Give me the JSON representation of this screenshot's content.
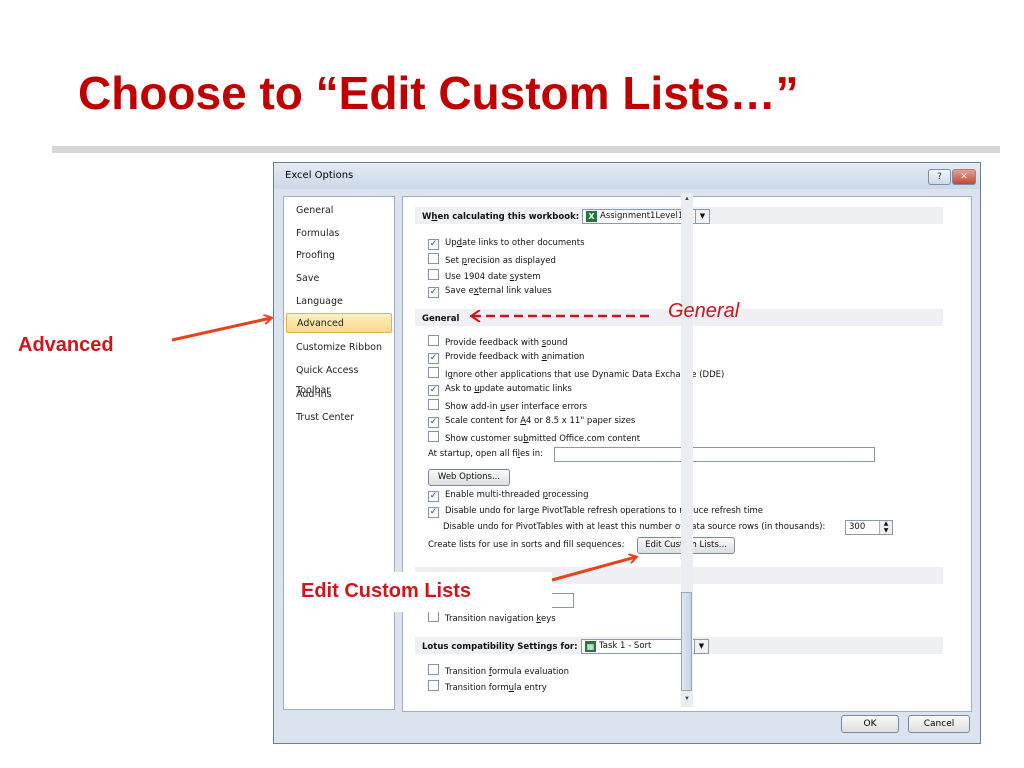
{
  "slide": {
    "title": "Choose to “Edit Custom Lists…”"
  },
  "dialog": {
    "title": "Excel Options",
    "help_label": "?",
    "close_label": "✕",
    "nav": [
      {
        "label": "General"
      },
      {
        "label": "Formulas"
      },
      {
        "label": "Proofing"
      },
      {
        "label": "Save"
      },
      {
        "label": "Language"
      },
      {
        "label": "Advanced",
        "selected": true
      },
      {
        "label": "Customize Ribbon"
      },
      {
        "label": "Quick Access Toolbar"
      },
      {
        "label": "Add-Ins"
      },
      {
        "label": "Trust Center"
      }
    ],
    "when_calculating": {
      "label_pre": "W",
      "label_u": "h",
      "label_post": "en calculating this workbook:",
      "workbook_value": "Assignment1Level1 ...",
      "options": [
        {
          "pre": "Up",
          "u": "d",
          "post": "ate links to other documents",
          "checked": true
        },
        {
          "pre": "Set ",
          "u": "p",
          "post": "recision as displayed",
          "checked": false
        },
        {
          "pre": "Use 1904 date ",
          "u": "s",
          "post": "ystem",
          "checked": false
        },
        {
          "pre": "Save e",
          "u": "x",
          "post": "ternal link values",
          "checked": true
        }
      ]
    },
    "general": {
      "header": "General",
      "options": [
        {
          "pre": "Provide feedback with ",
          "u": "s",
          "post": "ound",
          "checked": false
        },
        {
          "pre": "Provide feedback with ",
          "u": "a",
          "post": "nimation",
          "checked": true
        },
        {
          "pre": "I",
          "u": "g",
          "post": "nore other applications that use Dynamic Data Exchange (DDE)",
          "checked": false
        },
        {
          "pre": "Ask to ",
          "u": "u",
          "post": "pdate automatic links",
          "checked": true
        },
        {
          "pre": "Show add-in ",
          "u": "u",
          "post": "ser interface errors",
          "checked": false
        },
        {
          "pre": "Scale content for ",
          "u": "A",
          "post": "4 or 8.5 x 11\" paper sizes",
          "checked": true
        },
        {
          "pre": "Show customer su",
          "u": "b",
          "post": "mitted Office.com content",
          "checked": false
        }
      ],
      "startup_label": "At startup, open all fi",
      "startup_label_u": "l",
      "startup_label_post": "es in:",
      "startup_value": "",
      "web_options_button": "Web Options...",
      "options2": [
        {
          "pre": "Enable multi-threaded ",
          "u": "p",
          "post": "rocessing",
          "checked": true
        },
        {
          "pre": "Disable undo for large PivotTable refresh operations to reduce refresh time",
          "u": "",
          "post": "",
          "checked": true
        }
      ],
      "pivot_rows_label": "Disable undo for PivotTables with at least this number of data source rows (in thousands):",
      "pivot_rows_value": "300",
      "custom_lists_label": "Create lists for use in sorts and fill sequences:",
      "edit_custom_lists_button": "Edit Custom Lists..."
    },
    "lotus": {
      "transition_nav_pre": "Transition navigation ",
      "transition_nav_u": "k",
      "transition_nav_post": "eys",
      "header": "Lotus compatibility Settings for:",
      "sheet_value": "Task 1 - Sort",
      "options": [
        {
          "pre": "Transition ",
          "u": "f",
          "post": "ormula evaluation",
          "checked": false
        },
        {
          "pre": "Transition form",
          "u": "u",
          "post": "la entry",
          "checked": false
        }
      ]
    },
    "ok_button": "OK",
    "cancel_button": "Cancel"
  },
  "annotations": {
    "advanced": "Advanced",
    "general": "General",
    "edit_custom_lists": "Edit Custom Lists",
    "color": "#d0141a"
  }
}
